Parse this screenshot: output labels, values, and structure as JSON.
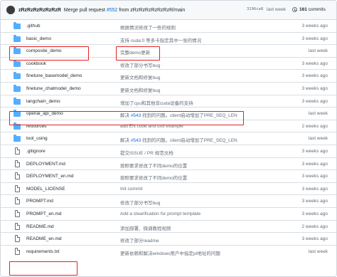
{
  "latest_commit": {
    "author": "zRzRzRzRzRzRzR",
    "message_prefix": "Merge pull request ",
    "pr": "#552",
    "message_suffix": " from zRzRzRzRzRzRzR/main",
    "sha": "3196ca8",
    "time": "last week",
    "commits_count": "161",
    "commits_label": " commits"
  },
  "files": [
    {
      "type": "folder",
      "name": ".github",
      "message": "根据情况修改了一些的规则",
      "age": "3 weeks ago"
    },
    {
      "type": "folder",
      "name": "basic_demo",
      "message": "支持 cuda:0 等多卡指定其中一张的情况",
      "age": "3 weeks ago"
    },
    {
      "type": "folder",
      "name": "composite_demo",
      "message": "完整demo更新",
      "age": "last week"
    },
    {
      "type": "folder",
      "name": "cookbook",
      "message": "修改了部分书写bug",
      "age": "3 weeks ago"
    },
    {
      "type": "folder",
      "name": "finetune_basemodel_demo",
      "message": "更新文档和修复bug",
      "age": "3 weeks ago"
    },
    {
      "type": "folder",
      "name": "finetune_chatmodel_demo",
      "message": "更新文档和修复bug",
      "age": "3 weeks ago"
    },
    {
      "type": "folder",
      "name": "langchain_demo",
      "message": "增加了cpu和其他非cuda设备的支持",
      "age": "3 weeks ago"
    },
    {
      "type": "folder",
      "name": "openai_api_demo",
      "message_prefix": "解决 ",
      "pr": "#543",
      "message": " 找到的问题。client启动增加了PRE_SEQ_LEN",
      "age": "last week"
    },
    {
      "type": "folder",
      "name": "resources",
      "message": "add EN code and tool example",
      "age": "2 weeks ago"
    },
    {
      "type": "folder",
      "name": "tool_using",
      "message_prefix": "解决 ",
      "pr": "#543",
      "message": " 找到的问题。client启动增加了PRE_SEQ_LEN",
      "age": "last week"
    },
    {
      "type": "file",
      "name": ".gitignore",
      "message": "提交ISSUE / PR 规范文档",
      "age": "3 weeks ago"
    },
    {
      "type": "file",
      "name": "DEPLOYMENT.md",
      "message": "按照要求修改了不同demo的位置",
      "age": "3 weeks ago"
    },
    {
      "type": "file",
      "name": "DEPLOYMENT_en.md",
      "message": "按照要求修改了不同demo的位置",
      "age": "3 weeks ago"
    },
    {
      "type": "file",
      "name": "MODEL_LICENSE",
      "message": "Init commit",
      "age": "3 weeks ago"
    },
    {
      "type": "file",
      "name": "PROMPT.md",
      "message": "修改了部分书写bug",
      "age": "3 weeks ago"
    },
    {
      "type": "file",
      "name": "PROMPT_en.md",
      "message": "Add a clearification for prompt template",
      "age": "3 weeks ago"
    },
    {
      "type": "file",
      "name": "README.md",
      "message": "添加部署、微调教程视频",
      "age": "2 weeks ago"
    },
    {
      "type": "file",
      "name": "README_en.md",
      "message": "修改了部分readme",
      "age": "3 weeks ago"
    },
    {
      "type": "file",
      "name": "requirements.txt",
      "message": "更新依赖和解决windows用户中指定pt地址的问题",
      "age": "last week"
    }
  ],
  "colors": {
    "highlight": "#e5211d",
    "folder": "#54aeff",
    "link": "#0969da",
    "muted": "#656d76"
  }
}
